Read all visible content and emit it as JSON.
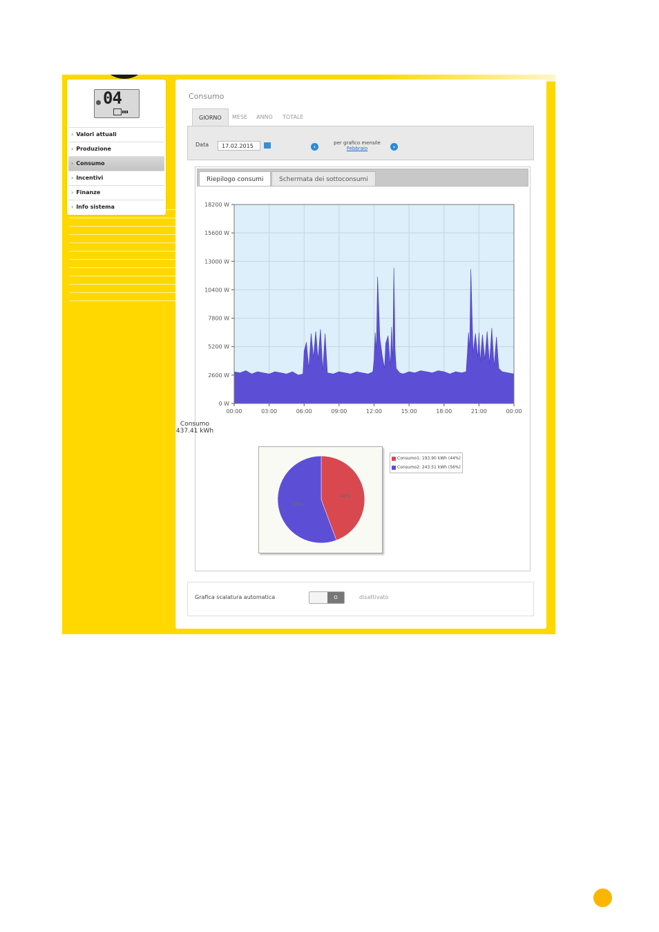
{
  "colors": {
    "yellow": "#FFD800",
    "series_blue": "#5c4fd6",
    "series_red": "#d9474f",
    "plot_bg": "#dceffb",
    "orange_dot": "#FBB600"
  },
  "device_display": {
    "digits": "04"
  },
  "sidebar": {
    "items": [
      {
        "label": "Valori attuali"
      },
      {
        "label": "Produzione"
      },
      {
        "label": "Consumo",
        "active": true
      },
      {
        "label": "Incentivi"
      },
      {
        "label": "Finanze"
      },
      {
        "label": "Info sistema"
      }
    ]
  },
  "main": {
    "title": "Consumo",
    "tabs": [
      "GIORNO",
      "MESE",
      "ANNO",
      "TOTALE"
    ],
    "selected_tab": "GIORNO",
    "date_label": "Data",
    "date_value": "17.02.2015",
    "monthly_label": "per grafico mensile",
    "monthly_link": "Febbraio",
    "subtabs": [
      "Riepilogo consumi",
      "Schermata dei sottoconsumi"
    ],
    "chart_caption_title": "Consumo",
    "chart_caption_total": "437.41 kWh",
    "auto_scale_label": "Grafica scalatura automatica",
    "auto_scale_toggle": "O",
    "auto_scale_state": "disattivato"
  },
  "chart_data": [
    {
      "type": "area",
      "xlabel": "",
      "ylabel": "",
      "x_ticks": [
        "00:00",
        "03:00",
        "06:00",
        "09:00",
        "12:00",
        "15:00",
        "18:00",
        "21:00",
        "00:00"
      ],
      "y_ticks": [
        "18200 W",
        "15600 W",
        "13000 W",
        "10400 W",
        "7800 W",
        "5200 W",
        "2600 W",
        "0 W"
      ],
      "ylim": [
        0,
        18200
      ],
      "xlim_hours": [
        0,
        24
      ],
      "grid": true,
      "series": [
        {
          "x": [
            0,
            0.5,
            1,
            1.5,
            2,
            2.5,
            3,
            3.5,
            4,
            4.5,
            5,
            5.5,
            5.9,
            6.0,
            6.2,
            6.4,
            6.6,
            6.8,
            7.0,
            7.2,
            7.4,
            7.6,
            7.8,
            8.0,
            8.5,
            9,
            9.5,
            10,
            10.5,
            11,
            11.5,
            11.9,
            12.0,
            12.1,
            12.2,
            12.3,
            12.5,
            12.7,
            12.9,
            13.0,
            13.2,
            13.4,
            13.5,
            13.6,
            13.7,
            13.8,
            13.9,
            14.2,
            14.5,
            15,
            15.5,
            16,
            16.5,
            17,
            17.5,
            18,
            18.5,
            19,
            19.5,
            19.9,
            20.0,
            20.1,
            20.2,
            20.3,
            20.5,
            20.7,
            20.9,
            21.0,
            21.1,
            21.3,
            21.5,
            21.7,
            21.9,
            22.1,
            22.3,
            22.5,
            22.7,
            23,
            23.5,
            24
          ],
          "y": [
            2900,
            2800,
            3000,
            2700,
            2900,
            2800,
            2700,
            2900,
            2800,
            2700,
            2900,
            2600,
            2700,
            4800,
            5600,
            3200,
            6400,
            4200,
            6600,
            4000,
            6800,
            3000,
            6400,
            2800,
            2700,
            2900,
            2800,
            2700,
            2900,
            2800,
            2700,
            2900,
            4000,
            6500,
            4800,
            11600,
            6000,
            4400,
            3200,
            5500,
            6200,
            3400,
            7000,
            3800,
            12400,
            5000,
            3200,
            2800,
            2700,
            2900,
            2800,
            3000,
            2900,
            2800,
            3000,
            2900,
            2700,
            2900,
            2800,
            2900,
            4500,
            6500,
            5000,
            12300,
            4600,
            6400,
            4200,
            6500,
            3800,
            6300,
            4000,
            6600,
            3600,
            6900,
            3400,
            6100,
            3200,
            2900,
            2800,
            2700
          ]
        }
      ]
    },
    {
      "type": "pie",
      "labels": [
        "Consumo1: 193.90 kWh (44%)",
        "Consumo2: 243.51 kWh (56%)"
      ],
      "values": [
        193.9,
        243.51
      ],
      "slice_labels": [
        "44%",
        "56%"
      ],
      "legend": "right"
    }
  ]
}
